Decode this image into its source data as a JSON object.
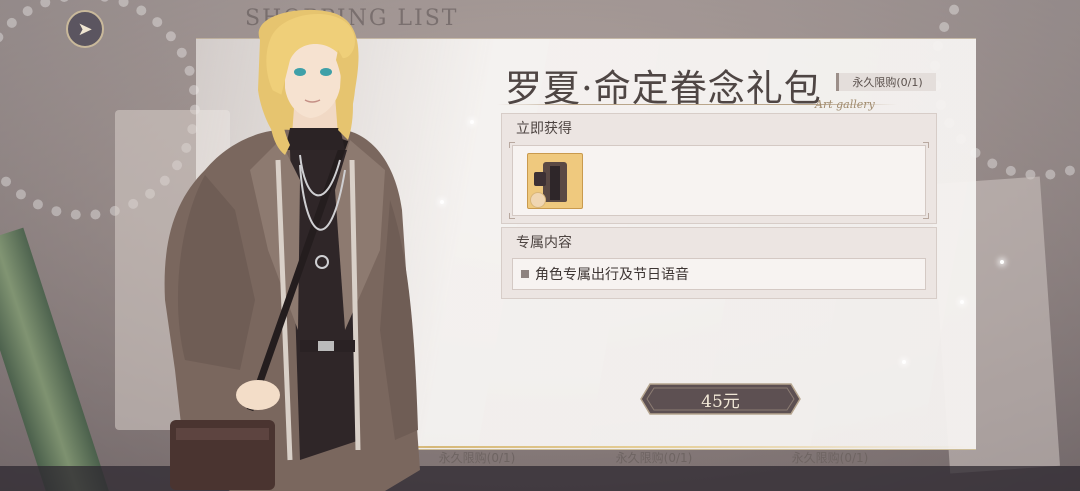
{
  "background": {
    "title": "SHOPPING LIST"
  },
  "nav": {
    "back_icon": "back-arrow-icon"
  },
  "pack": {
    "title": "罗夏·命定眷念礼包",
    "subtitle": "Art gallery",
    "limit_label": "永久限购(0/1)"
  },
  "sections": {
    "instant": {
      "header": "立即获得",
      "item_icon": "outfit-coat-icon"
    },
    "exclusive": {
      "header": "专属内容",
      "bullet_icon": "square-bullet-icon",
      "text": "角色专属出行及节日语音"
    }
  },
  "purchase": {
    "price_label": "45元"
  },
  "bottom_tabs": [
    {
      "label": "永久限购(0/1)"
    },
    {
      "label": "永久限购(0/1)"
    },
    {
      "label": "永久限购(0/1)"
    }
  ],
  "colors": {
    "accent_gold": "#d6b878",
    "price_button": "#5d5052",
    "title_text": "#4f4644"
  }
}
